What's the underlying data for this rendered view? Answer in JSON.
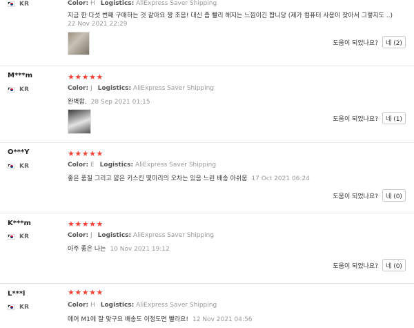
{
  "reviews": [
    {
      "name": "",
      "country": "KR",
      "color_label": "Color:",
      "color_value": "H",
      "logistics_label": "Logistics:",
      "logistics_value": "AliExpress Saver Shipping",
      "text": "지금 한 다섯 번째 구매하는 것 같아요 짱 조음! 대신 좀 빨리 해지는 느낌이긴 합니당 (제가 컴퓨터 사용이 잦아서 그렇지도 ..)",
      "date": "22 Nov 2021 22:29",
      "helpful_q": "도움이 되었나요?",
      "yes_label": "네 (2)"
    },
    {
      "name": "M***m",
      "country": "KR",
      "stars": "★★★★★",
      "color_label": "Color:",
      "color_value": "J",
      "logistics_label": "Logistics:",
      "logistics_value": "AliExpress Saver Shipping",
      "text": "완벽함.",
      "date": "28 Sep 2021 01:15",
      "helpful_q": "도움이 되었나요?",
      "yes_label": "네 (1)"
    },
    {
      "name": "O***Y",
      "country": "KR",
      "stars": "★★★★★",
      "color_label": "Color:",
      "color_value": "E",
      "logistics_label": "Logistics:",
      "logistics_value": "AliExpress Saver Shipping",
      "text": "좋은 품질 그리고 얇은 키스킨 몇미리의 오차는 있음 느린 배송 아쉬움",
      "date": "17 Oct 2021 06:24",
      "helpful_q": "도움이 되었나요?",
      "yes_label": "네 (0)"
    },
    {
      "name": "K***m",
      "country": "KR",
      "stars": "★★★★★",
      "color_label": "Color:",
      "color_value": "J",
      "logistics_label": "Logistics:",
      "logistics_value": "AliExpress Saver Shipping",
      "text": "아주 좋은 나는",
      "date": "10 Nov 2021 19:12",
      "helpful_q": "도움이 되었나요?",
      "yes_label": "네 (0)"
    },
    {
      "name": "L***l",
      "country": "KR",
      "stars": "★★★★★",
      "color_label": "Color:",
      "color_value": "H",
      "logistics_label": "Logistics:",
      "logistics_value": "AliExpress Saver Shipping",
      "text": "에어 M1에 잘 맞구요 배송도 이정도면 빨라요!",
      "date": "12 Nov 2021 04:56"
    }
  ],
  "colors": {
    "star": "#f44336",
    "flag_red": "#c60c30",
    "flag_blue": "#003478"
  }
}
